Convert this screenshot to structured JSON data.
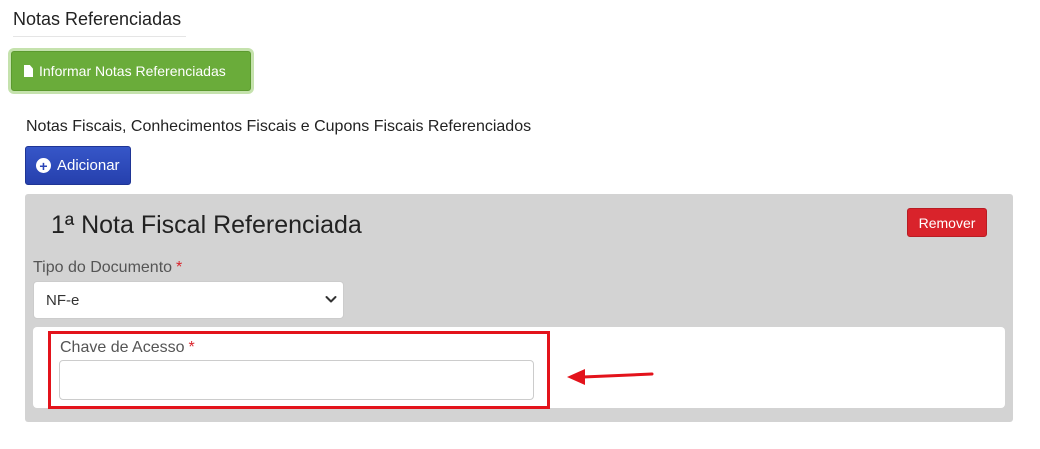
{
  "section": {
    "title": "Notas Referenciadas"
  },
  "actions": {
    "informar_label": "Informar Notas Referenciadas",
    "subtitle": "Notas Fiscais, Conhecimentos Fiscais e Cupons Fiscais Referenciados",
    "adicionar_label": "Adicionar"
  },
  "panel": {
    "title": "1ª Nota Fiscal Referenciada",
    "remover_label": "Remover",
    "tipo": {
      "label": "Tipo do Documento",
      "required_mark": "*",
      "selected": "NF-e"
    },
    "chave": {
      "label": "Chave de Acesso",
      "required_mark": "*",
      "value": ""
    }
  },
  "colors": {
    "green_button": "#6aac3a",
    "blue_button": "#2b45b7",
    "red_button": "#d9232b",
    "highlight": "#e3131b",
    "panel_bg": "#d3d3d3"
  },
  "icons": {
    "informar": "document-icon",
    "adicionar": "plus-circle-icon",
    "select": "chevron-down-icon",
    "annotation": "arrow-left-icon"
  }
}
